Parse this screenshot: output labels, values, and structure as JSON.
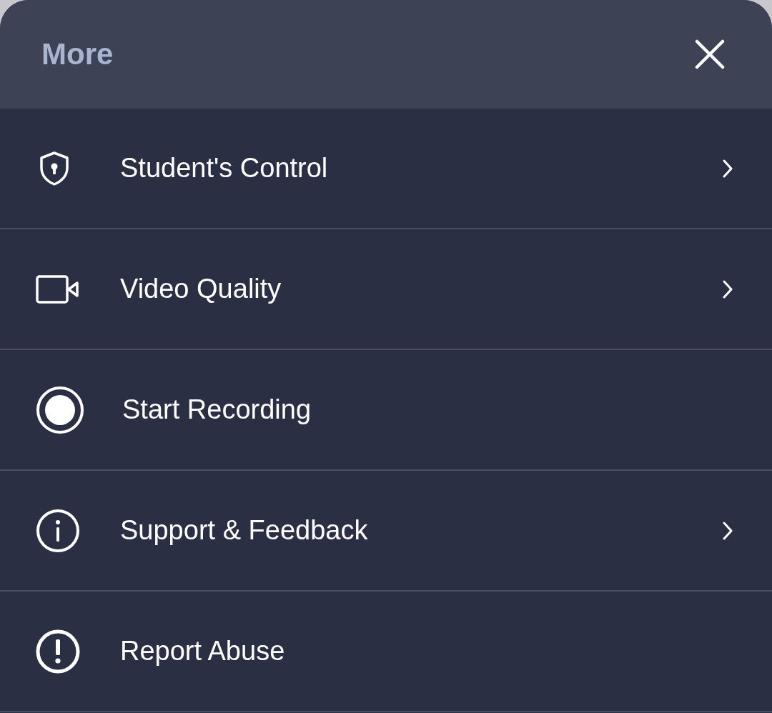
{
  "header": {
    "title": "More"
  },
  "items": [
    {
      "label": "Student's Control",
      "kind": "submenu"
    },
    {
      "label": "Video Quality",
      "kind": "submenu"
    },
    {
      "label": "Start Recording",
      "kind": "action"
    },
    {
      "label": "Support & Feedback",
      "kind": "submenu"
    },
    {
      "label": "Report Abuse",
      "kind": "action"
    }
  ]
}
